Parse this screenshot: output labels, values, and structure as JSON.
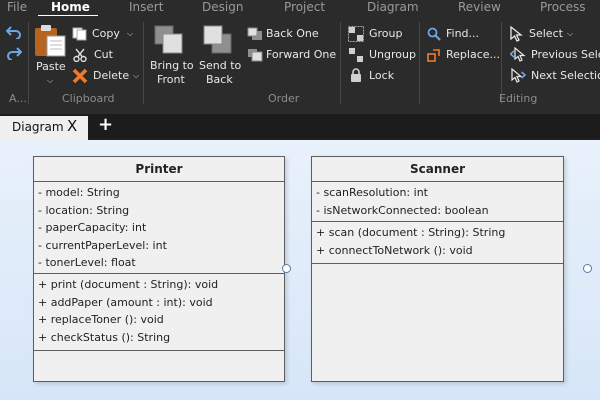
{
  "menu": {
    "items": [
      "File",
      "Home",
      "Insert",
      "Design",
      "Project",
      "Diagram",
      "Review",
      "Process"
    ],
    "active": "Home"
  },
  "ribbon": {
    "collapsed_label": "A...",
    "clipboard": {
      "paste": "Paste",
      "copy": "Copy",
      "cut": "Cut",
      "delete": "Delete",
      "group_label": "Clipboard"
    },
    "order": {
      "bring_to_front_1": "Bring to",
      "bring_to_front_2": "Front",
      "send_to_back_1": "Send to",
      "send_to_back_2": "Back",
      "back_one": "Back One",
      "forward_one": "Forward One",
      "group_label": "Order"
    },
    "grouping": {
      "group": "Group",
      "ungroup": "Ungroup",
      "lock": "Lock"
    },
    "editing": {
      "find": "Find...",
      "replace": "Replace...",
      "select": "Select",
      "previous_selection": "Previous Selec",
      "next_selection": "Next Selection",
      "group_label": "Editing"
    }
  },
  "tabs": {
    "active_tab": "Diagram",
    "close_glyph": "X",
    "add_glyph": "+"
  },
  "diagram": {
    "printer": {
      "name": "Printer",
      "attributes": [
        "- model: String",
        "- location: String",
        "- paperCapacity: int",
        "- currentPaperLevel: int",
        "- tonerLevel: float"
      ],
      "methods": [
        "+ print (document : String): void",
        "+ addPaper (amount : int): void",
        "+ replaceToner (): void",
        "+ checkStatus (): String"
      ]
    },
    "scanner": {
      "name": "Scanner",
      "attributes": [
        "- scanResolution: int",
        "- isNetworkConnected: boolean"
      ],
      "methods": [
        "+ scan (document : String): String",
        "+ connectToNetwork (): void"
      ]
    }
  }
}
